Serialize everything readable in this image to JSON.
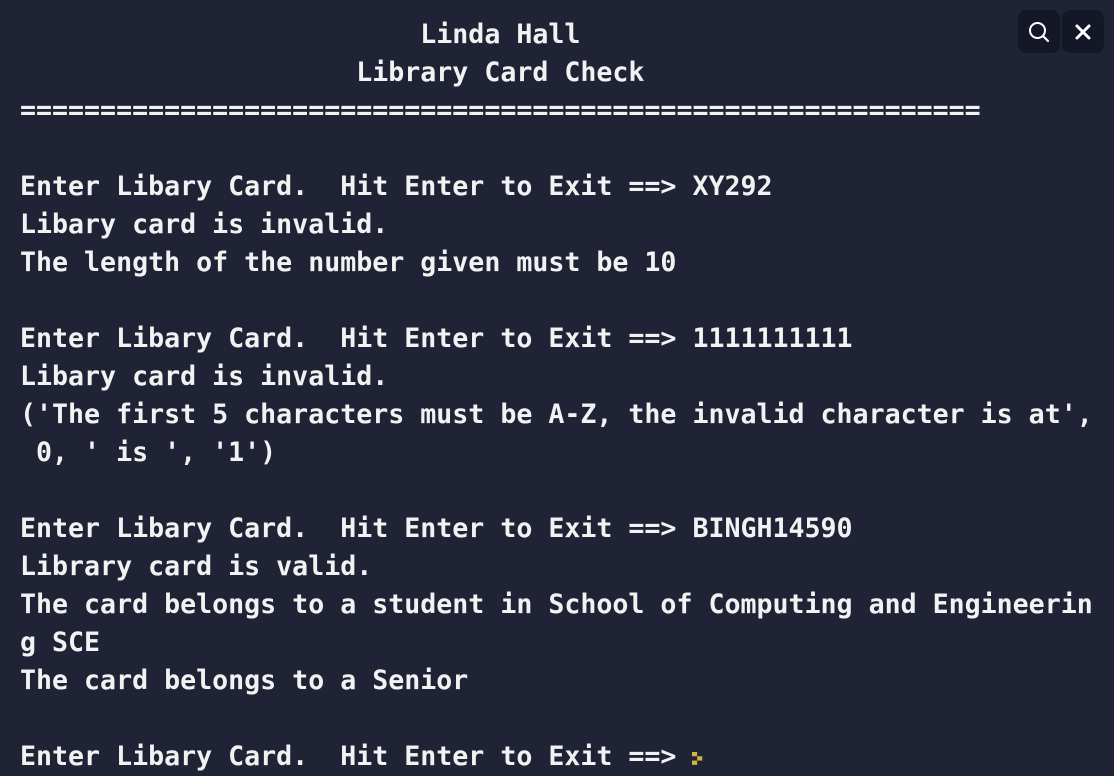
{
  "terminal": {
    "lines": [
      "                         Linda Hall",
      "                     Library Card Check",
      "============================================================",
      "",
      "Enter Libary Card.  Hit Enter to Exit ==> XY292",
      "Libary card is invalid.",
      "The length of the number given must be 10",
      "",
      "Enter Libary Card.  Hit Enter to Exit ==> 1111111111",
      "Libary card is invalid.",
      "('The first 5 characters must be A-Z, the invalid character is at',",
      " 0, ' is ', '1')",
      "",
      "Enter Libary Card.  Hit Enter to Exit ==> BINGH14590",
      "Library card is valid.",
      "The card belongs to a student in School of Computing and Engineerin",
      "g SCE",
      "The card belongs to a Senior",
      "",
      "Enter Libary Card.  Hit Enter to Exit ==> "
    ]
  },
  "toolbar": {
    "search_icon": "search-icon",
    "close_icon": "close-icon"
  },
  "colors": {
    "background": "#1f2335",
    "text": "#f2f2f2",
    "cursor": "#d4b43c"
  }
}
